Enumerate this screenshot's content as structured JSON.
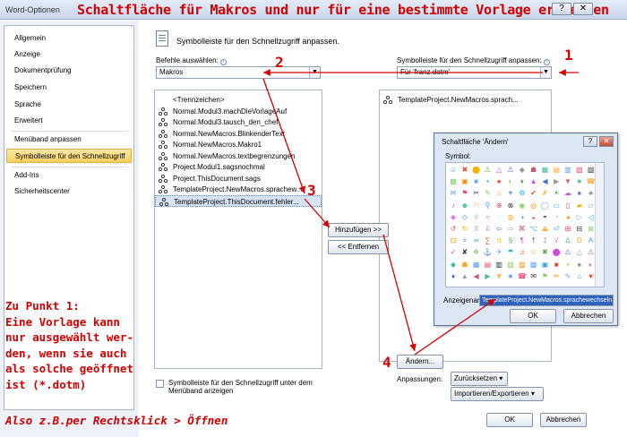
{
  "window": {
    "title": "Word-Optionen",
    "annotation_title": "Schaltfläche für Makros und nur für eine bestimmte Vorlage erstellen",
    "controls": [
      "?",
      "✕"
    ]
  },
  "sidebar": {
    "items": [
      {
        "label": "Allgemein",
        "active": false
      },
      {
        "label": "Anzeige",
        "active": false
      },
      {
        "label": "Dokumentprüfung",
        "active": false
      },
      {
        "label": "Speichern",
        "active": false
      },
      {
        "label": "Sprache",
        "active": false
      },
      {
        "label": "Erweitert",
        "active": false
      },
      {
        "label": "Menüband anpassen",
        "active": false
      },
      {
        "label": "Symbolleiste für den Schnellzugriff",
        "active": true
      },
      {
        "label": "Add-Ins",
        "active": false
      },
      {
        "label": "Sicherheitscenter",
        "active": false
      }
    ]
  },
  "main": {
    "heading": "Symbolleiste für den Schnellzugriff anpassen.",
    "commands_label": "Befehle auswählen:",
    "commands_value": "Makros",
    "toolbar_label": "Symbolleiste für den Schnellzugriff anpassen:",
    "toolbar_value": "Für 'franz.dotm'",
    "commands": [
      "<Trennzeichen>",
      "Normal.Modul3.machDieVorlageAuf",
      "Normal.Modul3.tausch_den_chef",
      "Normal.NewMacros.BlinkenderText",
      "Normal.NewMacros.Makro1",
      "Normal.NewMacros.textbegrenzungen",
      "Project.Modul1.sagsnochmal",
      "Project.ThisDocument.sags",
      "TemplateProject.NewMacros.sprachew...",
      "TemplateProject.ThisDocument.fehler..."
    ],
    "selected_command_index": 9,
    "toolbar_items": [
      "TemplateProject.NewMacros.sprach..."
    ],
    "add_button": "Hinzufügen >>",
    "remove_button": "<< Entfernen",
    "modify_button": "Ändern...",
    "customizations_label": "Anpassungen:",
    "reset_button": "Zurücksetzen",
    "import_export_button": "Importieren/Exportieren",
    "below_ribbon_checkbox": "Symbolleiste für den Schnellzugriff unter dem Menüband anzeigen",
    "ok_button": "OK",
    "cancel_button": "Abbrechen"
  },
  "dialog": {
    "title": "Schaltfläche 'Ändern'",
    "symbol_label": "Symbol:",
    "display_name_label": "Anzeigename:",
    "display_name_value": "TemplateProject.NewMacros.sprachewechseln",
    "ok_button": "OK",
    "cancel_button": "Abbrechen",
    "help_button": "?",
    "close_button": "✕"
  },
  "annotations": {
    "n1": "1",
    "n2": "2",
    "n3": "3",
    "n4": "4",
    "note_lines": [
      "Zu Punkt 1:",
      "Eine Vorlage kann",
      "nur ausgewählt wer-",
      "den, wenn sie auch",
      "als solche geöffnet",
      "ist (*.dotm)"
    ],
    "bottom_note": "Also z.B.per Rechtsklick > Öffnen"
  },
  "colors": {
    "annotation": "#d40000",
    "selection": "#f7cf5e",
    "dialog_bg": "#dde7f4"
  }
}
